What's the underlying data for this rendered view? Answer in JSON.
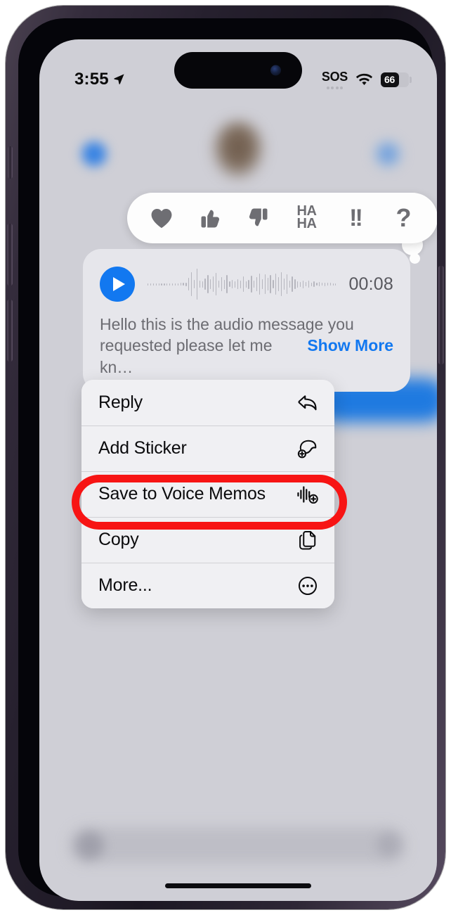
{
  "status_bar": {
    "time": "3:55",
    "location_icon": "location-arrow-icon",
    "sos_label": "SOS",
    "cellular_icon": "cellular-dots-icon",
    "wifi_icon": "wifi-icon",
    "battery_level": "66",
    "battery_percent": 66
  },
  "reactions": {
    "items": [
      {
        "name": "heart",
        "glyph": "heart-icon"
      },
      {
        "name": "thumbs-up",
        "glyph": "thumbs-up-icon"
      },
      {
        "name": "thumbs-down",
        "glyph": "thumbs-down-icon"
      },
      {
        "name": "haha",
        "line1": "HA",
        "line2": "HA"
      },
      {
        "name": "exclamation",
        "text": "!!"
      },
      {
        "name": "question",
        "text": "?"
      }
    ]
  },
  "audio_message": {
    "play_icon": "play-icon",
    "duration": "00:08",
    "transcript_line_1": "Hello this is the audio message you",
    "transcript_line_2": "requested please let me kn…",
    "show_more_label": "Show More"
  },
  "context_menu": {
    "items": [
      {
        "label": "Reply",
        "icon": "reply-arrow-icon",
        "highlighted": false
      },
      {
        "label": "Add Sticker",
        "icon": "sticker-plus-icon",
        "highlighted": false
      },
      {
        "label": "Save to Voice Memos",
        "icon": "waveform-plus-icon",
        "highlighted": true
      },
      {
        "label": "Copy",
        "icon": "copy-documents-icon",
        "highlighted": false
      },
      {
        "label": "More...",
        "icon": "ellipsis-circle-icon",
        "highlighted": false
      }
    ]
  },
  "annotation": {
    "type": "oval-highlight",
    "color": "#f71414",
    "target": "Save to Voice Memos"
  },
  "colors": {
    "accent_blue": "#1278f0",
    "bubble_gray": "#e6e6eb",
    "screen_background": "#cfcfd6",
    "menu_background": "#f0f0f3",
    "annotation_red": "#f71414"
  },
  "device": {
    "home_indicator": "home-indicator",
    "buttons": [
      "silent-switch",
      "volume-up",
      "volume-down",
      "power-button"
    ]
  }
}
